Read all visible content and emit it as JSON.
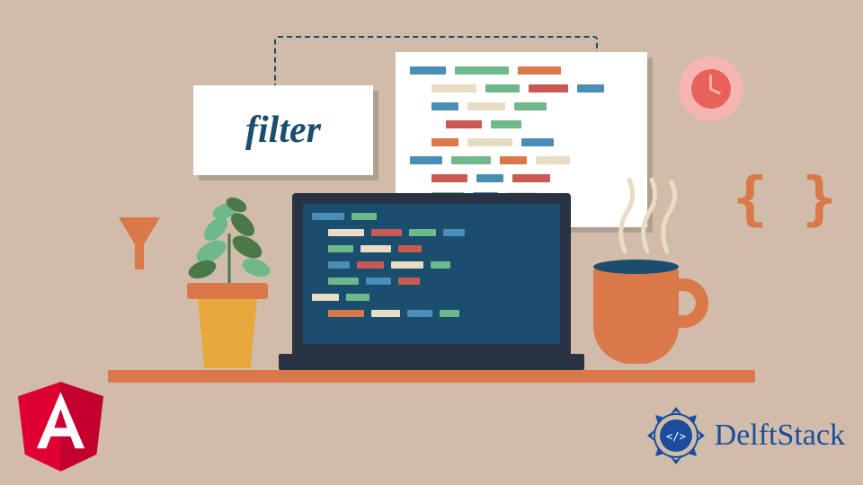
{
  "filter_label": "filter",
  "braces_text": "{ }",
  "brand_text": "DelftStack",
  "icons": {
    "clock": "clock-icon",
    "funnel": "funnel-icon",
    "braces": "braces-icon",
    "mug": "coffee-mug-icon",
    "plant": "plant-icon",
    "angular": "angular-logo",
    "delft": "delftstack-logo"
  },
  "colors": {
    "bg": "#d1bca9",
    "accent": "#d97848",
    "dark": "#1a4d6e",
    "navy": "#2a3344"
  }
}
